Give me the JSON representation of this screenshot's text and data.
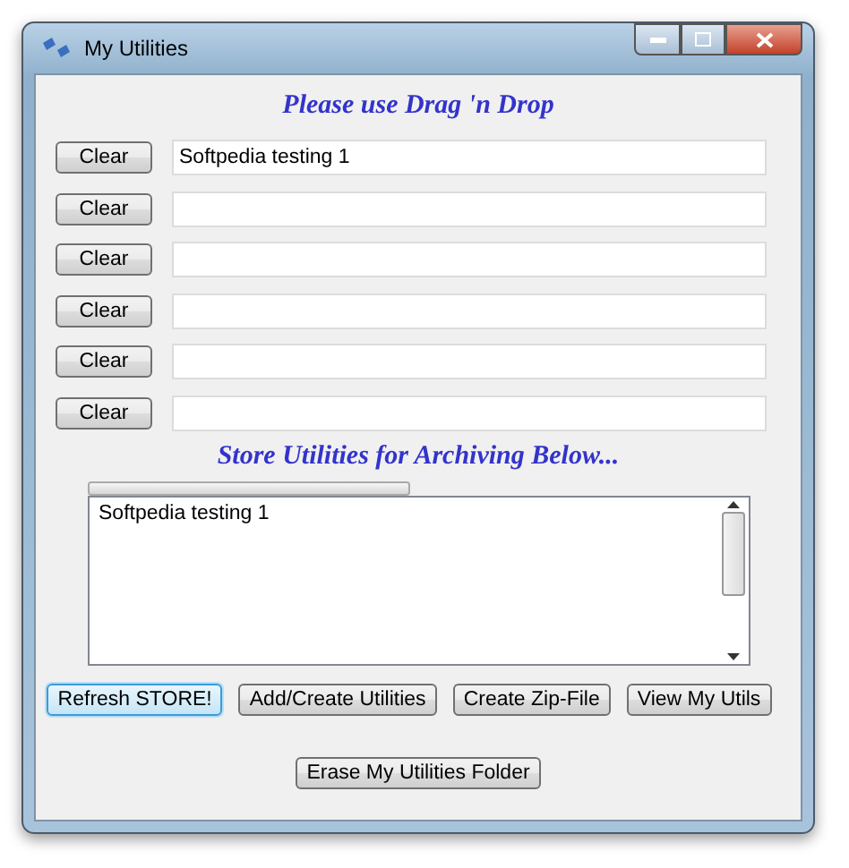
{
  "window": {
    "title": "My Utilities"
  },
  "heading": "Please use Drag 'n Drop",
  "slots": [
    {
      "button": "Clear",
      "value": "Softpedia testing 1"
    },
    {
      "button": "Clear"
    },
    {
      "button": "Clear"
    },
    {
      "button": "Clear"
    },
    {
      "button": "Clear"
    },
    {
      "button": "Clear"
    }
  ],
  "store_heading": "Store Utilities for Archiving Below...",
  "progress": {
    "level": 1
  },
  "store_list": {
    "items": [
      "Softpedia testing 1"
    ]
  },
  "buttons": [
    {
      "label": "Refresh STORE!",
      "focused": true
    },
    {
      "label": "Add/Create Utilities",
      "focused": false
    },
    {
      "label": "Create Zip-File",
      "focused": false
    },
    {
      "label": "View My Utils",
      "focused": false
    }
  ],
  "bottom_button": {
    "label": "Erase My Utilities Folder",
    "focused": false
  }
}
